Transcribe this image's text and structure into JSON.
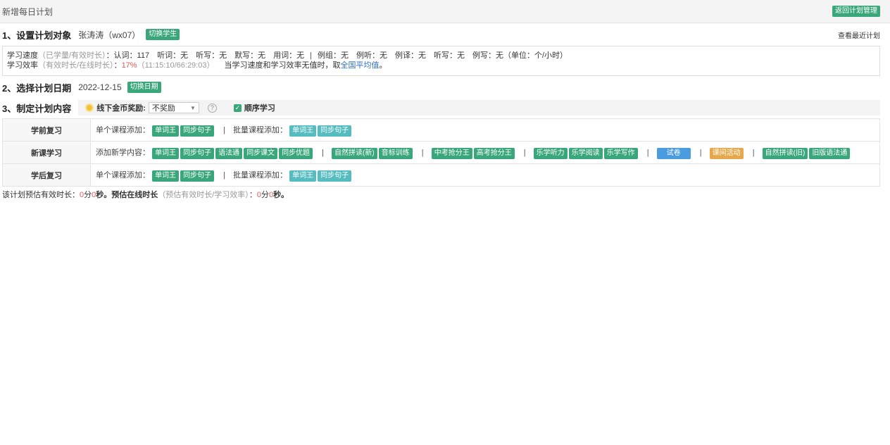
{
  "header": {
    "title": "新增每日计划",
    "back_button": "返回计划管理"
  },
  "section1": {
    "heading": "1、设置计划对象",
    "student": "张涛涛（wx07）",
    "switch_button": "切换学生",
    "recent_link": "查看最近计划"
  },
  "stats": {
    "speed_label": "学习速度",
    "speed_hint": "（已学量/有效时长）",
    "speed_items": "：认词：117　听词：无　听写：无　默写：无　用词：无",
    "speed_items2": "例组：无　例听：无　例译：无　听写：无　例写：无（单位：个/小时）",
    "eff_label": "学习效率",
    "eff_hint": "（有效时长/在线时长）",
    "eff_colon": "：",
    "eff_value": "17%",
    "eff_detail": "（11:15:10/66:29:03）",
    "eff_note": "当学习速度和学习效率无值时，取",
    "eff_link": "全国平均值",
    "eff_end": "。"
  },
  "section2": {
    "heading": "2、选择计划日期",
    "date": "2022-12-15",
    "switch_button": "切换日期"
  },
  "section3": {
    "heading": "3、制定计划内容",
    "reward_label": "线下金币奖励:",
    "reward_value": "不奖励",
    "help": "?",
    "sequential_label": "顺序学习"
  },
  "plan_rows": {
    "pre": {
      "label": "学前复习",
      "single_label": "单个课程添加：",
      "single_buttons": [
        "单词王",
        "同步句子"
      ],
      "batch_label": "批量课程添加：",
      "batch_buttons": [
        "单词王",
        "同步句子"
      ]
    },
    "new": {
      "label": "新课学习",
      "add_label": "添加新学内容：",
      "group1": [
        "单词王",
        "同步句子",
        "语法通",
        "同步课文",
        "同步优题"
      ],
      "group2": [
        "自然拼读(新)",
        "音标训练"
      ],
      "group3": [
        "中考抢分王",
        "高考抢分王"
      ],
      "group4": [
        "乐学听力",
        "乐学阅读",
        "乐学写作"
      ],
      "group5": "试卷",
      "group6": "课间活动",
      "group7": [
        "自然拼读(旧)",
        "旧版语法通"
      ]
    },
    "post": {
      "label": "学后复习",
      "single_label": "单个课程添加：",
      "single_buttons": [
        "单词王",
        "同步句子"
      ],
      "batch_label": "批量课程添加：",
      "batch_buttons": [
        "单词王",
        "同步句子"
      ]
    }
  },
  "footer": {
    "t1": "该计划预估有效时长：",
    "m1": "0",
    "u1": "分",
    "s1": "0",
    "u2": "秒。预估在线时长",
    "hint": "（预估有效时长/学习效率）",
    "t2": "：",
    "m2": "0",
    "u3": "分",
    "s2": "0",
    "u4": "秒。"
  },
  "colors": {
    "green": "#3aa77b",
    "teal": "#55bcc0",
    "blue": "#4a9be0",
    "orange": "#e7a84c",
    "red": "#e05a5a"
  }
}
